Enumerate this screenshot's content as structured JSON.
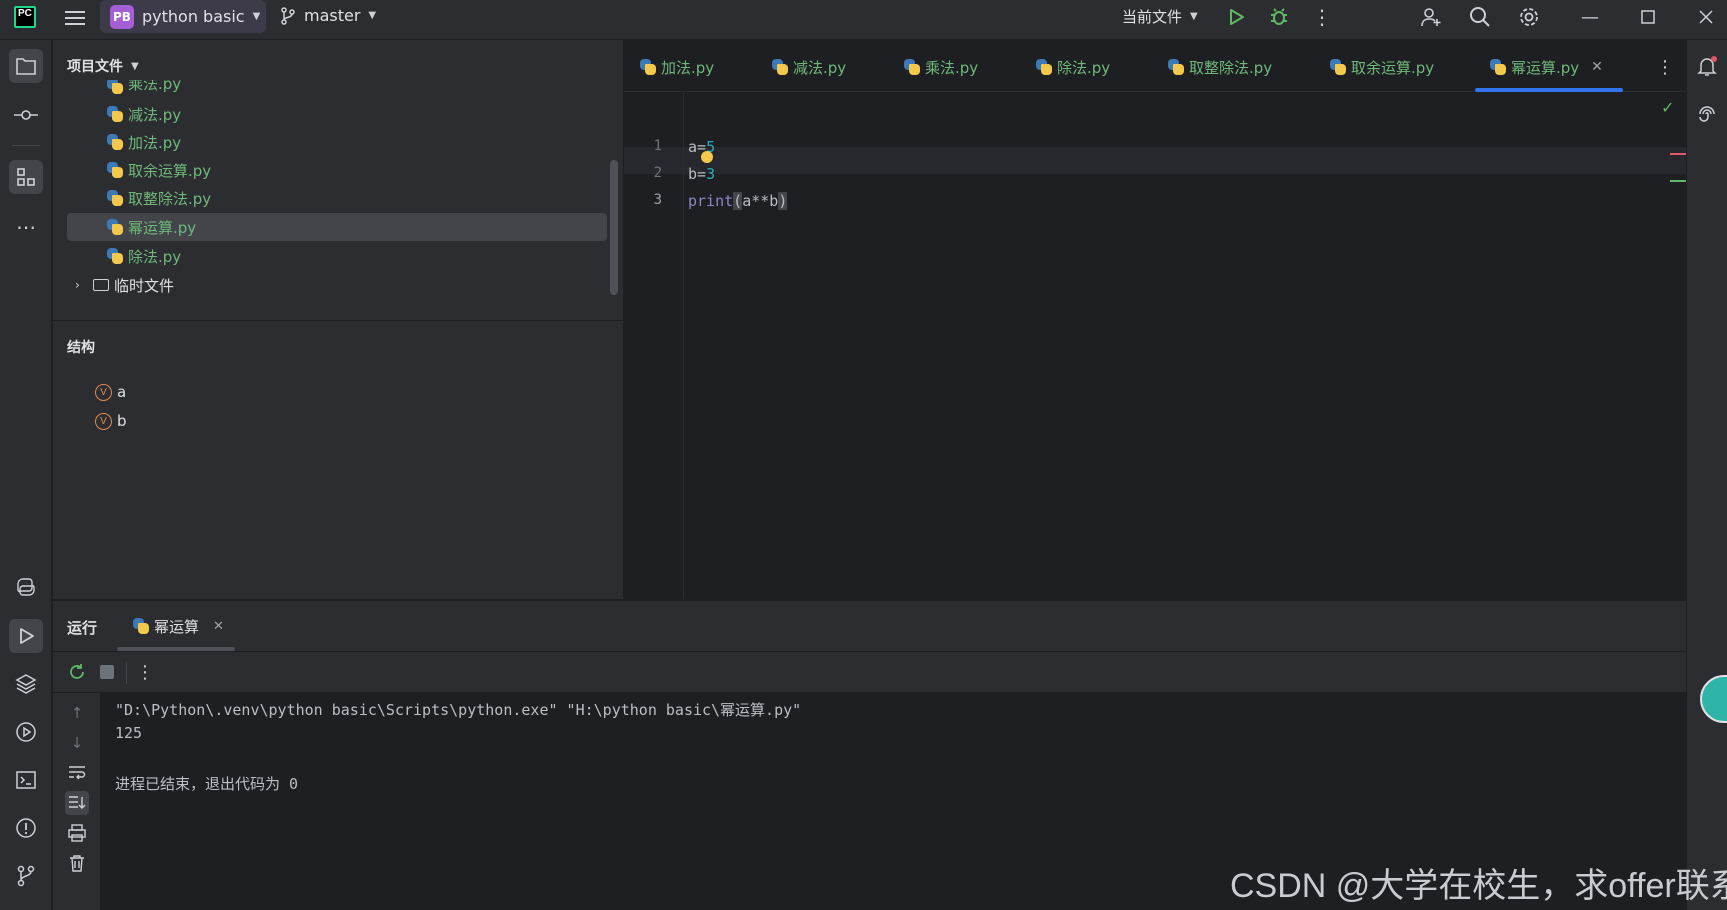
{
  "titlebar": {
    "logo_text": "PC",
    "project_badge": "PB",
    "project_name": "python basic",
    "branch": "master",
    "run_config": "当前文件"
  },
  "project_panel": {
    "title": "项目文件",
    "files": [
      "乘法.py",
      "减法.py",
      "加法.py",
      "取余运算.py",
      "取整除法.py",
      "幂运算.py",
      "除法.py"
    ],
    "selected_index": 5,
    "folder": "临时文件"
  },
  "structure_panel": {
    "title": "结构",
    "var_badge": "V",
    "items": [
      "a",
      "b"
    ]
  },
  "editor": {
    "tabs": [
      "加法.py",
      "减法.py",
      "乘法.py",
      "除法.py",
      "取整除法.py",
      "取余运算.py",
      "幂运算.py"
    ],
    "active_tab": "幂运算.py",
    "line_numbers": [
      "1",
      "2",
      "3"
    ],
    "code": {
      "l1_var": "a=",
      "l1_num": "5",
      "l2_var": "b=",
      "l2_num": "3",
      "l3_fn": "print",
      "l3_open": "(",
      "l3_body": "a**b",
      "l3_close": ")"
    }
  },
  "run_panel": {
    "title": "运行",
    "tab_label": "幂运算",
    "console": {
      "command": "\"D:\\Python\\.venv\\python basic\\Scripts\\python.exe\" \"H:\\python basic\\幂运算.py\"",
      "output": "125",
      "exit_message": "进程已结束，退出代码为 0"
    }
  },
  "watermark": "CSDN @大学在校生，求offer联系",
  "colors": {
    "accent": "#3574f0",
    "file_green": "#6fb87a",
    "number": "#2aacb8",
    "builtin": "#8888c6",
    "run_green": "#5fb865"
  }
}
